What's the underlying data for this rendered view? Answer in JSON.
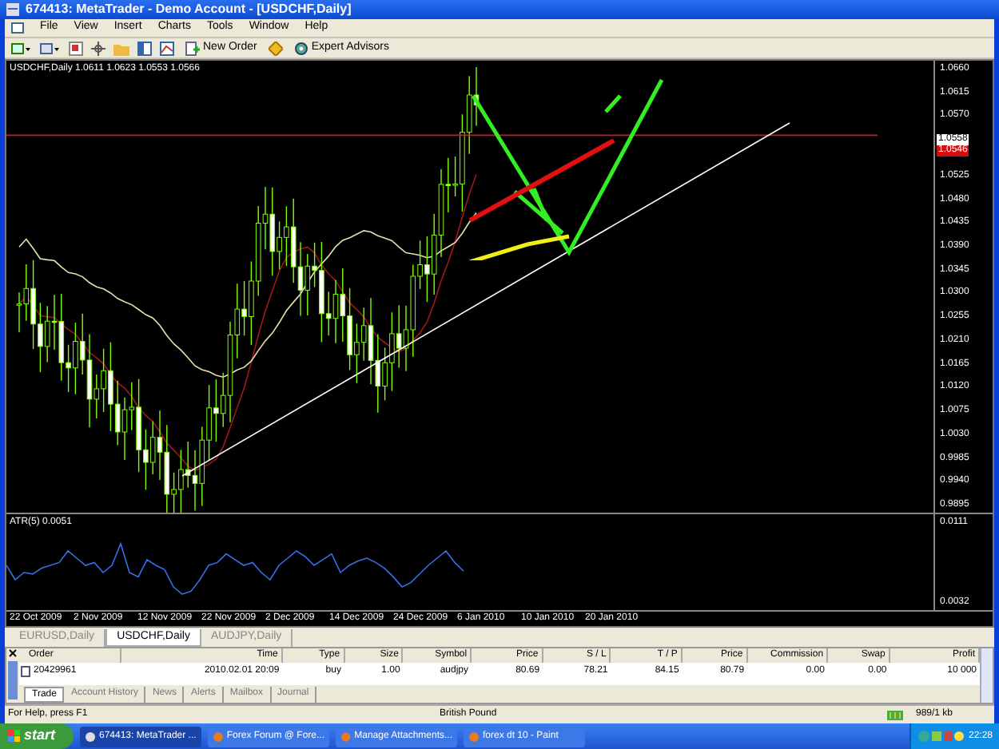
{
  "window": {
    "title": "674413: MetaTrader - Demo Account - [USDCHF,Daily]"
  },
  "menu": [
    "File",
    "View",
    "Insert",
    "Charts",
    "Tools",
    "Window",
    "Help"
  ],
  "toolbar": {
    "buttons": [
      {
        "label": "New Order",
        "kind": "order"
      },
      {
        "label": "Expert Advisors",
        "kind": "experts"
      }
    ]
  },
  "chart": {
    "header": "USDCHF,Daily  1.0611 1.0623 1.0553 1.0566",
    "price_labels": [
      "1.0660",
      "1.0615",
      "1.0570",
      "1.0525",
      "1.0480",
      "1.0435",
      "1.0390",
      "1.0345",
      "1.0300",
      "1.0255",
      "1.0210",
      "1.0165",
      "1.0120",
      "1.0075",
      "1.0030",
      "0.9985",
      "0.9940",
      "0.9895"
    ],
    "current_prices": [
      {
        "text": "1.0558",
        "kind": "bid"
      },
      {
        "text": "1.0546",
        "kind": "ask"
      }
    ],
    "indicator": {
      "label": "ATR(5) 0.0051",
      "labels": [
        "0.0111",
        "0.0032"
      ]
    },
    "dates": [
      "22 Oct 2009",
      "2 Nov 2009",
      "12 Nov 2009",
      "22 Nov 2009",
      "2 Dec 2009",
      "14 Dec 2009",
      "24 Dec 2009",
      "6 Jan 2010",
      "10 Jan 2010",
      "20 Jan 2010"
    ]
  },
  "chart_tabs": [
    {
      "label": "EURUSD,Daily",
      "selected": false
    },
    {
      "label": "USDCHF,Daily",
      "selected": true
    },
    {
      "label": "AUDJPY,Daily",
      "selected": false
    }
  ],
  "terminal": {
    "columns": [
      "Order",
      "Time",
      "Type",
      "Size",
      "Symbol",
      "Price",
      "S / L",
      "T / P",
      "Price",
      "Commission",
      "Swap",
      "Profit"
    ],
    "rows": [
      {
        "cells": [
          "20429961",
          "2010.02.01 20:09",
          "buy",
          "1.00",
          "audjpy",
          "80.69",
          "78.21",
          "84.15",
          "80.79",
          "0.00",
          "0.00",
          "10 000"
        ]
      }
    ],
    "tabs": [
      {
        "label": "Trade",
        "selected": true
      },
      {
        "label": "Account History",
        "selected": false
      },
      {
        "label": "News",
        "selected": false
      },
      {
        "label": "Alerts",
        "selected": false
      },
      {
        "label": "Mailbox",
        "selected": false
      },
      {
        "label": "Journal",
        "selected": false
      }
    ]
  },
  "status_bar": {
    "help": "For Help, press F1",
    "profile": "British Pound",
    "traffic": "989/1 kb"
  },
  "taskbar": {
    "start": "start",
    "tasks": [
      {
        "label": "674413: MetaTrader ...",
        "selected": true
      },
      {
        "label": "Forex Forum @ Fore...",
        "selected": false
      },
      {
        "label": "Manage Attachments...",
        "selected": false
      },
      {
        "label": "forex dt 10 - Paint",
        "selected": false
      }
    ],
    "clock": "22:28"
  }
}
